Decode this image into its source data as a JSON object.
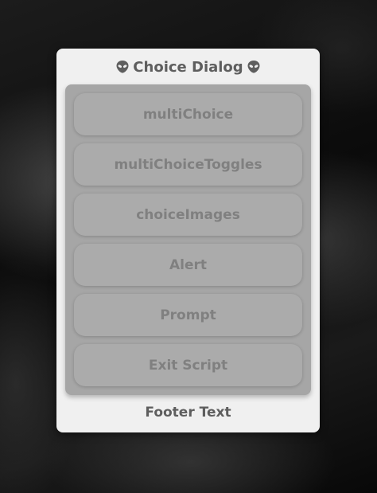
{
  "dialog": {
    "title": "Choice Dialog",
    "title_icon": "alien-icon",
    "options": [
      {
        "label": "multiChoice"
      },
      {
        "label": "multiChoiceToggles"
      },
      {
        "label": "choiceImages"
      },
      {
        "label": "Alert"
      },
      {
        "label": "Prompt"
      },
      {
        "label": "Exit Script"
      }
    ],
    "footer": "Footer Text"
  },
  "colors": {
    "dialog_background": "#f0f0f0",
    "panel_background": "#a6a6a6",
    "button_background": "#ababab",
    "button_text": "#808080",
    "title_text": "#5e5e5e"
  }
}
